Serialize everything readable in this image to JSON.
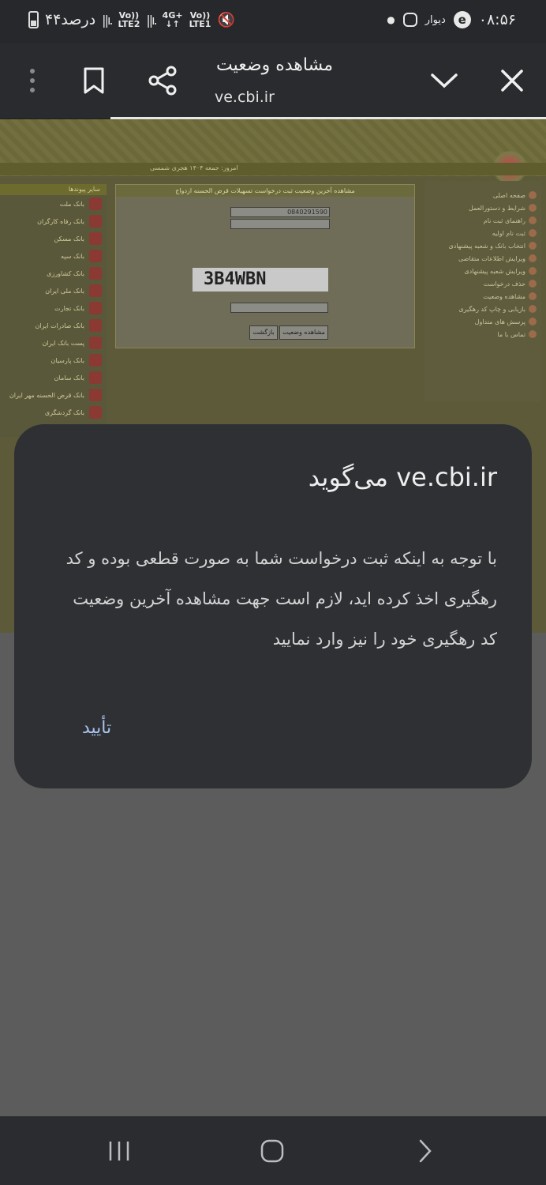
{
  "status_bar": {
    "time": "۰۸:۵۶",
    "app_label": "دیوار",
    "battery": "۴۴درصد",
    "sim1": {
      "line1": "Vo))",
      "line2": "LTE2"
    },
    "sim2": {
      "line1": "Vo))",
      "line2": "LTE1"
    },
    "network": "4G+"
  },
  "browser": {
    "page_title": "مشاهده وضعیت",
    "url": "ve.cbi.ir"
  },
  "website": {
    "band_text": "امروز: جمعه ۱۴۰۴ هجری شمسی",
    "form_header": "مشاهده آخرین وضعیت ثبت درخواست تسهیلات قرض الحسنه ازدواج",
    "request_code": "0840291590",
    "captcha_text": "3B4WBN",
    "buttons": {
      "view": "مشاهده وضعیت",
      "back": "بازگشت"
    },
    "menu_items": [
      "صفحه اصلی",
      "شرایط و دستورالعمل",
      "راهنمای ثبت نام",
      "ثبت نام اولیه",
      "انتخاب بانک و شعبه پیشنهادی",
      "ویرایش اطلاعات متقاضی",
      "ویرایش شعبه پیشنهادی",
      "حذف درخواست",
      "مشاهده وضعیت",
      "بازیابی و چاپ کد رهگیری",
      "پرسش های متداول",
      "تماس با ما"
    ],
    "banks_header": "سایر پیوندها",
    "banks": [
      "بانک ملت",
      "بانک رفاه کارگران",
      "بانک مسکن",
      "بانک سپه",
      "بانک کشاورزی",
      "بانک ملی ایران",
      "بانک تجارت",
      "بانک صادرات ایران",
      "پست بانک ایران",
      "بانک پارسیان",
      "بانک سامان",
      "بانک قرض الحسنه مهر ایران",
      "بانک گردشگری"
    ]
  },
  "dialog": {
    "title": "ve.cbi.ir می‌گوید",
    "message": "با توجه به اینکه ثبت درخواست شما به صورت قطعی بوده و کد رهگیری اخذ کرده اید، لازم است جهت مشاهده آخرین وضعیت کد رهگیری خود را نیز وارد نمایید",
    "ok_label": "تأیید"
  },
  "icons": {
    "close": "close-icon",
    "expand": "chevron-down-icon",
    "share": "share-icon",
    "bookmark": "bookmark-icon",
    "more": "more-vert-icon"
  }
}
